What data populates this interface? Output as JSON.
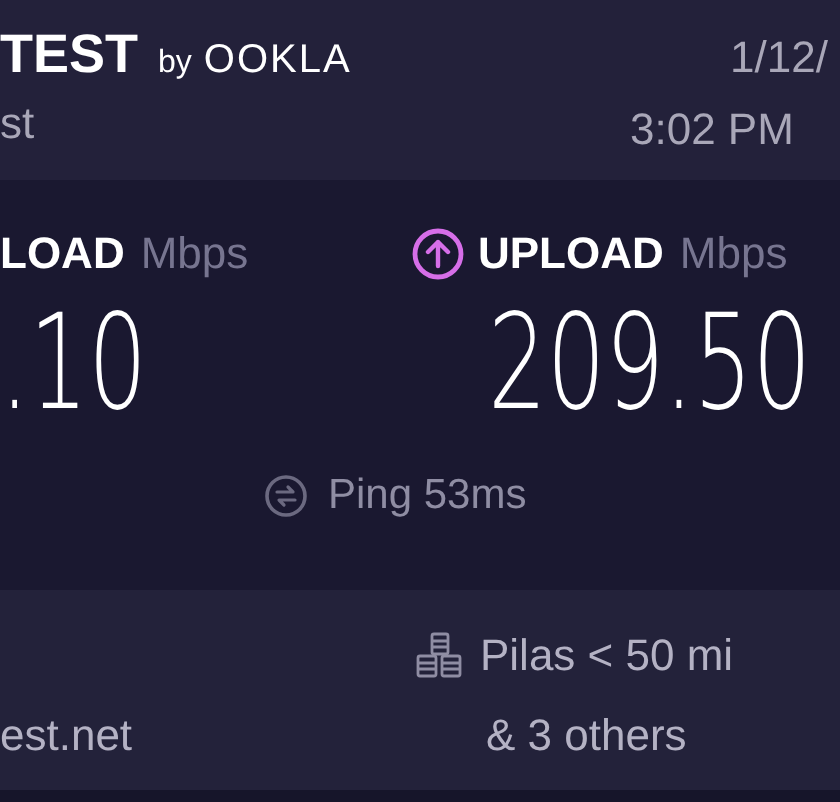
{
  "header": {
    "logo_text": "TEST",
    "logo_by": "by",
    "logo_brand": "OOKLA",
    "subtitle": "st",
    "date": "1/12/",
    "time": "3:02 PM"
  },
  "results": [
    {
      "kind": "download",
      "label": "LOAD",
      "unit": "Mbps",
      "value": ".10"
    },
    {
      "kind": "upload",
      "label": "UPLOAD",
      "unit": "Mbps",
      "value": "209.50"
    }
  ],
  "ping": {
    "label": "Ping 53ms"
  },
  "footer": {
    "provider": "est.net",
    "server": "Pilas < 50 mi",
    "server_note": "& 3 others"
  }
}
